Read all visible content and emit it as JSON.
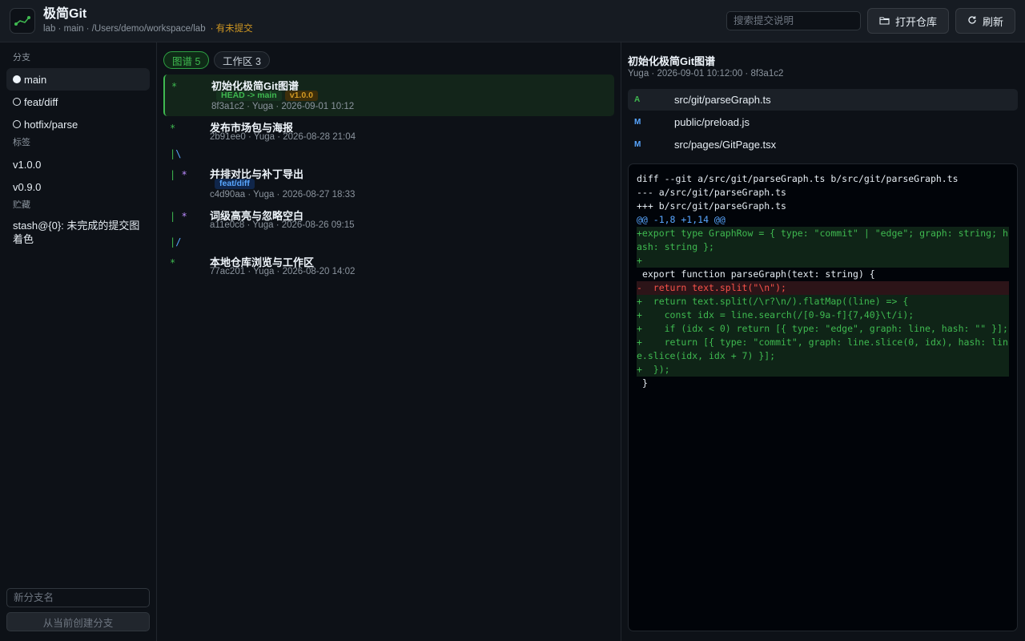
{
  "header": {
    "app_title": "极简Git",
    "subtitle": "lab · main · /Users/demo/workspace/lab",
    "uncommitted": "· 有未提交",
    "search_placeholder": "搜索提交说明",
    "open_repo_label": "打开仓库",
    "refresh_label": "刷新"
  },
  "sidebar": {
    "branches_label": "分支",
    "branches": [
      "main",
      "feat/diff",
      "hotfix/parse"
    ],
    "current_branch": "main",
    "tags_label": "标签",
    "tags": [
      "v1.0.0",
      "v0.9.0"
    ],
    "stash_label": "贮藏",
    "stashes": [
      "stash@{0}: 未完成的提交图着色"
    ],
    "new_branch_placeholder": "新分支名",
    "create_branch_label": "从当前创建分支"
  },
  "tabs": {
    "graph": "图谱 5",
    "worktree": "工作区 3"
  },
  "commits": [
    {
      "graph": "*",
      "title": "初始化极简Git图谱",
      "meta": "8f3a1c2 · Yuga · 2026-09-01 10:12",
      "head": "HEAD -> main",
      "tag": "v1.0.0"
    },
    {
      "graph": "*",
      "title": "发布市场包与海报",
      "meta": "2b91ee0 · Yuga · 2026-08-28 21:04"
    },
    {
      "graph": "| *",
      "title": "并排对比与补丁导出",
      "meta": "c4d90aa · Yuga · 2026-08-27 18:33",
      "branch": "feat/diff"
    },
    {
      "graph": "| *",
      "title": "词级高亮与忽略空白",
      "meta": "a11e0c8 · Yuga · 2026-08-26 09:15"
    },
    {
      "graph": "*",
      "title": "本地仓库浏览与工作区",
      "meta": "77ac201 · Yuga · 2026-08-20 14:02"
    }
  ],
  "edges": [
    "|\\",
    "|/"
  ],
  "detail": {
    "title": "初始化极简Git图谱",
    "meta": "Yuga · 2026-09-01 10:12:00 · 8f3a1c2",
    "files": [
      {
        "status": "A",
        "path": "src/git/parseGraph.ts"
      },
      {
        "status": "M",
        "path": "public/preload.js"
      },
      {
        "status": "M",
        "path": "src/pages/GitPage.tsx"
      }
    ],
    "diff": [
      "diff --git a/src/git/parseGraph.ts b/src/git/parseGraph.ts",
      "--- a/src/git/parseGraph.ts",
      "+++ b/src/git/parseGraph.ts",
      "@@ -1,8 +1,14 @@",
      "+export type GraphRow = { type: \"commit\" | \"edge\"; graph: string; hash: string };",
      "+",
      " export function parseGraph(text: string) {",
      "-  return text.split(\"\\n\");",
      "+  return text.split(/\\r?\\n/).flatMap((line) => {",
      "+    const idx = line.search(/[0-9a-f]{7,40}\\t/i);",
      "+    if (idx < 0) return [{ type: \"edge\", graph: line, hash: \"\" }];",
      "+    return [{ type: \"commit\", graph: line.slice(0, idx), hash: line.slice(idx, idx + 7) }];",
      "+  });",
      " }"
    ]
  },
  "colors": {
    "accent": "#3fb950",
    "warn": "#d29922",
    "link": "#58a6ff",
    "graph_branch": "#bc8cff",
    "removed": "#f85149"
  }
}
